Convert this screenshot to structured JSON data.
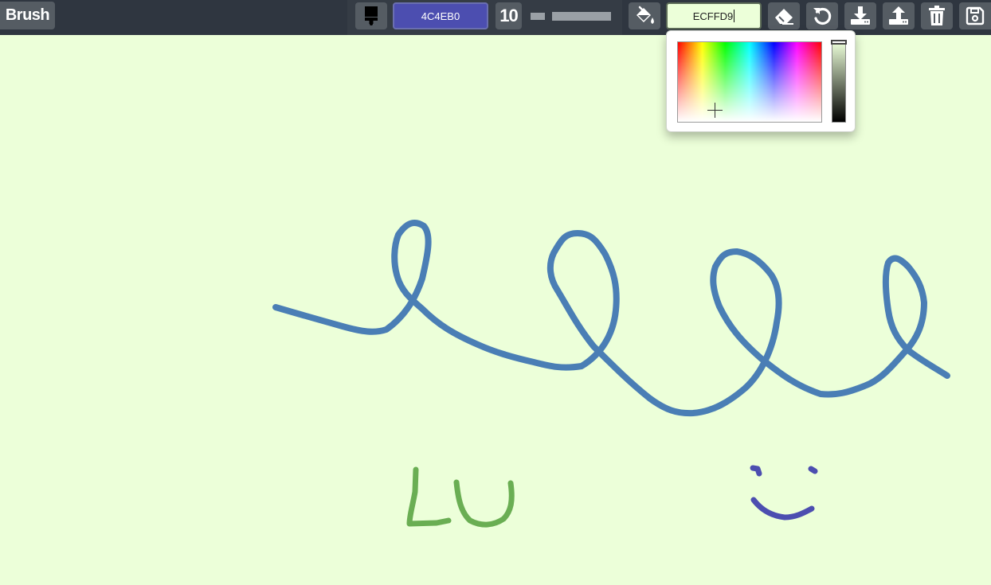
{
  "toolbar": {
    "mode_label": "Brush",
    "brush_color": "4C4EB0",
    "brush_size": "10",
    "brush_size_percent": 5,
    "background_color": "ECFFD9",
    "icons": [
      "brush-icon",
      "paint-bucket-icon",
      "eraser-icon",
      "undo-icon",
      "download-icon",
      "upload-icon",
      "trash-icon",
      "save-icon"
    ]
  },
  "colors": {
    "brush": "#4C4EB0",
    "background": "#ECFFD9",
    "stroke_blue": "#4A7EB5",
    "stroke_green": "#6AAE53",
    "stroke_purple": "#4C4EB0"
  },
  "color_picker": {
    "open": true,
    "value_level": 0
  },
  "drawing": {
    "text_strokes": [
      "LU"
    ]
  }
}
